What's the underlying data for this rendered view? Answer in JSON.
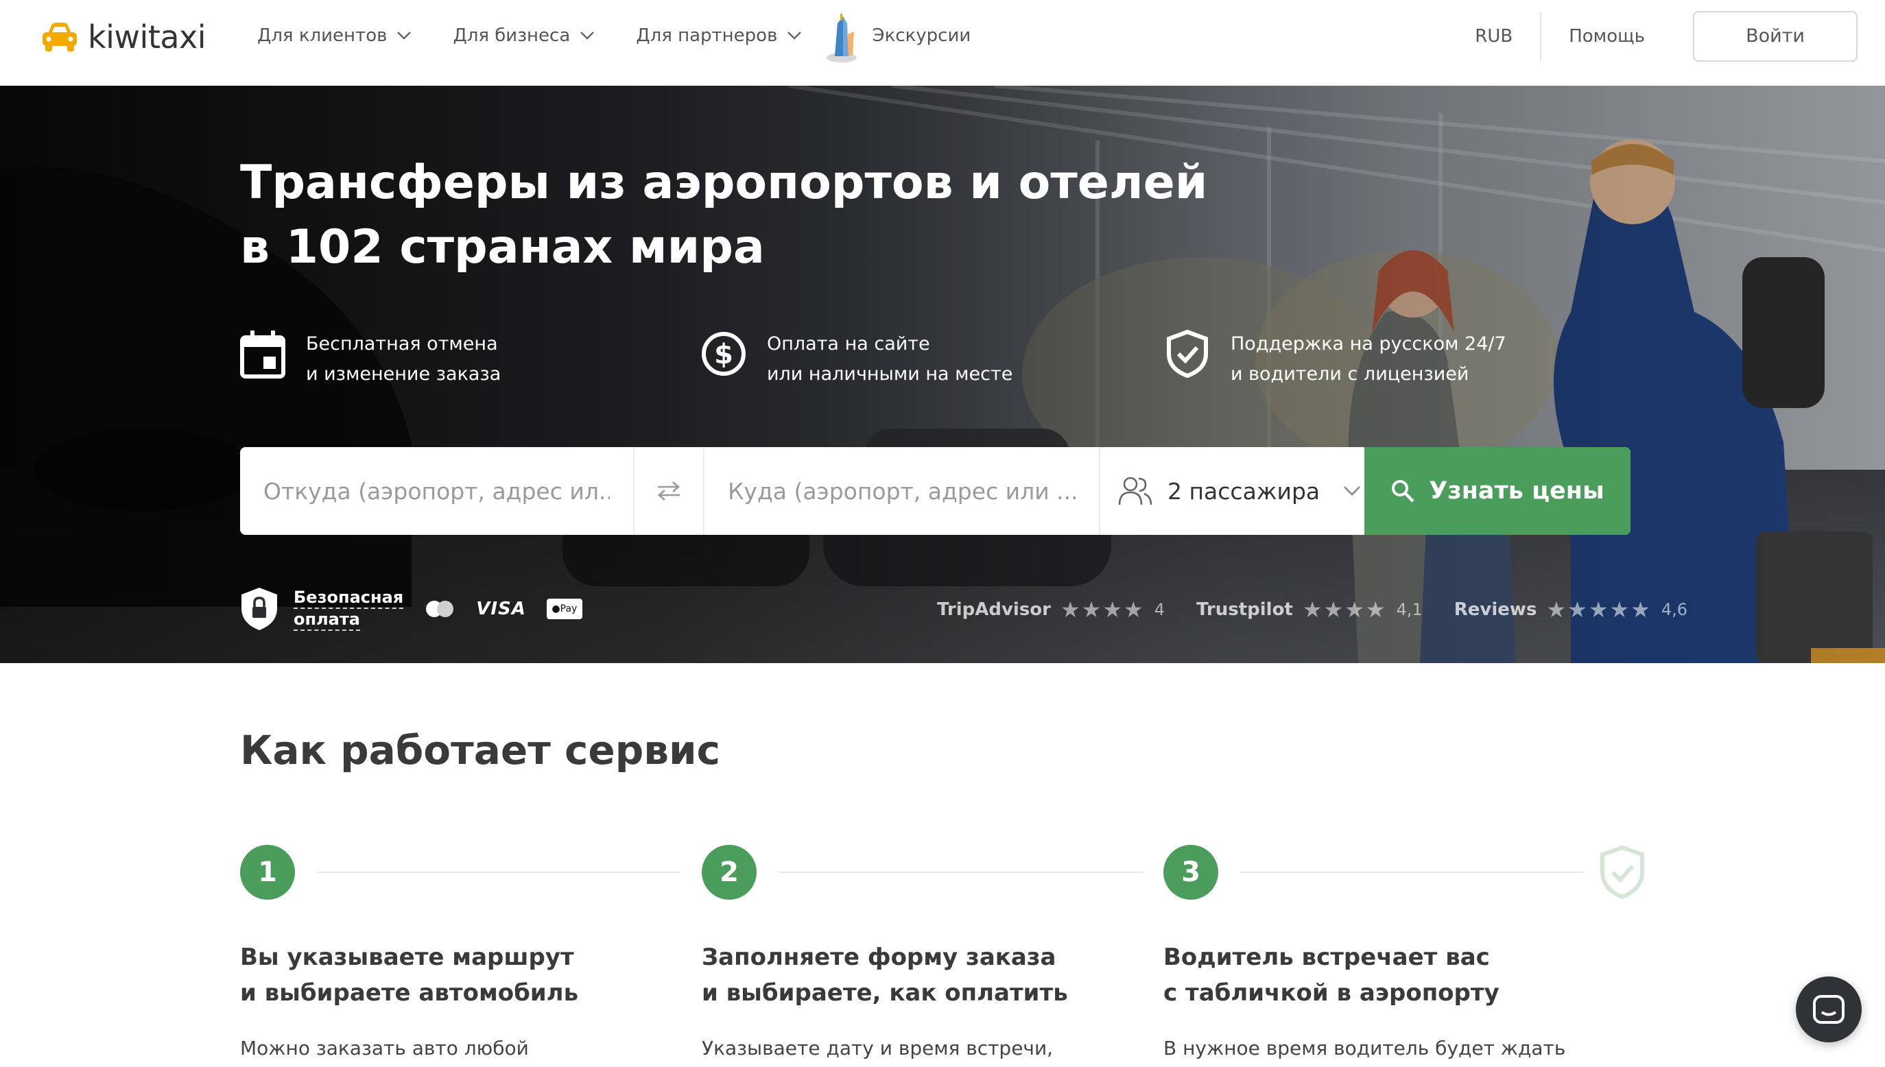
{
  "header": {
    "logo_text": "kiwitaxi",
    "nav": [
      {
        "label": "Для клиентов"
      },
      {
        "label": "Для бизнеса"
      },
      {
        "label": "Для партнеров"
      }
    ],
    "excursions_label": "Экскурсии",
    "currency": "RUB",
    "help": "Помощь",
    "login": "Войти"
  },
  "hero": {
    "title_line1": "Трансферы из аэропортов и отелей",
    "title_line2": "в 102 странах мира",
    "features": [
      {
        "icon": "calendar-icon",
        "line1": "Бесплатная отмена",
        "line2": "и изменение заказа"
      },
      {
        "icon": "dollar-icon",
        "line1": "Оплата на сайте",
        "line2": "или наличными на месте"
      },
      {
        "icon": "shield-check-icon",
        "line1": "Поддержка на русском 24/7",
        "line2": "и водители с лицензией"
      }
    ],
    "search": {
      "from_placeholder": "Откуда (аэропорт, адрес ил...",
      "to_placeholder": "Куда (аэропорт, адрес или ...",
      "passengers": "2 пассажира",
      "button": "Узнать цены"
    },
    "secure_line1": "Безопасная",
    "secure_line2": "оплата",
    "visa": "VISA",
    "apple_pay": "Pay",
    "ratings": [
      {
        "name": "TripAdvisor",
        "stars": "★★★★",
        "score": "4"
      },
      {
        "name": "Trustpilot",
        "stars": "★★★★",
        "score": "4,1"
      },
      {
        "name": "Reviews",
        "stars": "★★★★★",
        "score": "4,6"
      }
    ]
  },
  "how": {
    "title": "Как работает сервис",
    "steps": [
      {
        "num": "1",
        "title_line1": "Вы указываете маршрут",
        "title_line2": "и выбираете автомобиль",
        "desc": "Можно заказать авто любой"
      },
      {
        "num": "2",
        "title_line1": "Заполняете форму заказа",
        "title_line2": "и выбираете, как оплатить",
        "desc": "Указываете дату и время встречи,"
      },
      {
        "num": "3",
        "title_line1": "Водитель встречает вас",
        "title_line2": "с табличкой в аэропорту",
        "desc": "В нужное время водитель будет ждать"
      }
    ]
  },
  "colors": {
    "accent_green": "#4a9d5b",
    "text_dark": "#3a3a3a",
    "chat_bg": "#2f3338"
  }
}
